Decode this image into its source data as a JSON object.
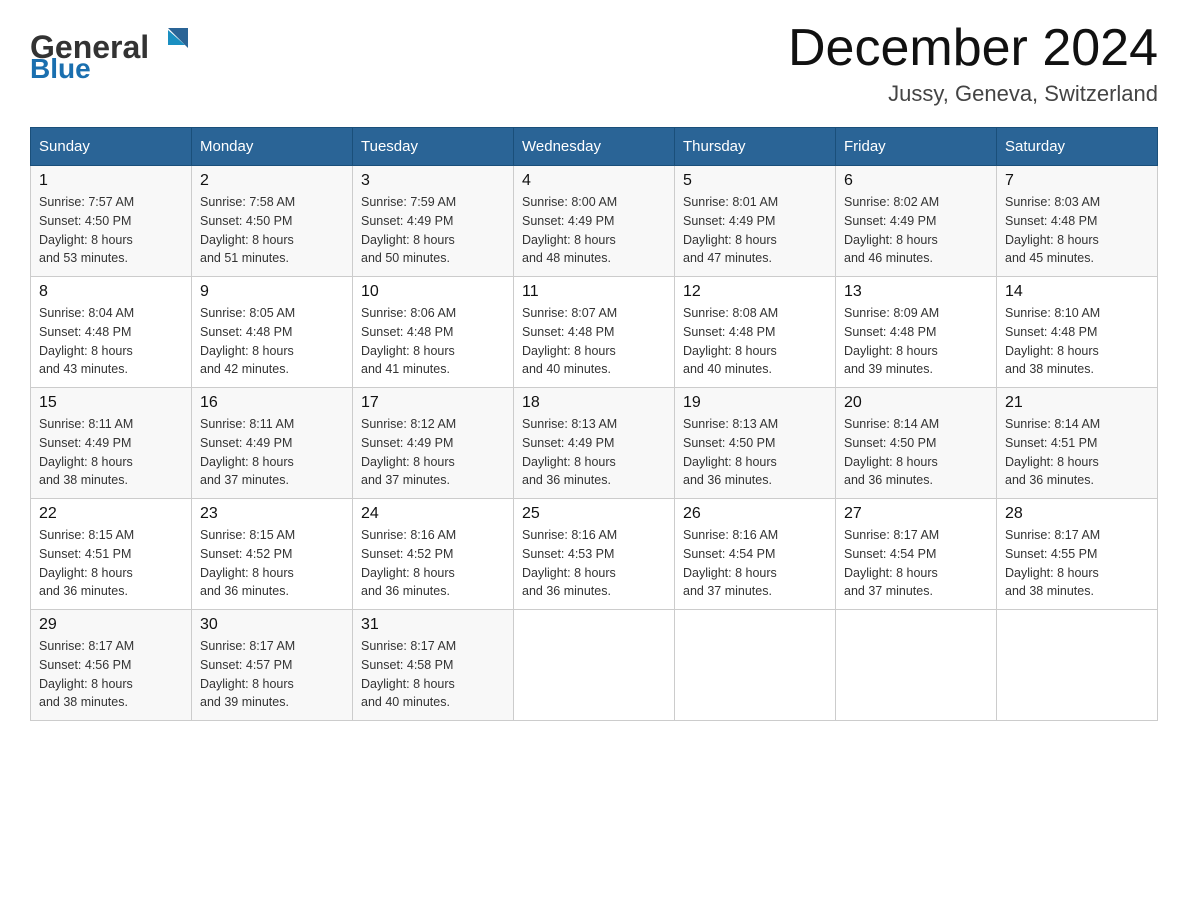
{
  "logo": {
    "text_general": "General",
    "text_blue": "Blue"
  },
  "title": {
    "month": "December 2024",
    "location": "Jussy, Geneva, Switzerland"
  },
  "headers": [
    "Sunday",
    "Monday",
    "Tuesday",
    "Wednesday",
    "Thursday",
    "Friday",
    "Saturday"
  ],
  "weeks": [
    [
      {
        "day": "1",
        "sunrise": "7:57 AM",
        "sunset": "4:50 PM",
        "daylight": "8 hours and 53 minutes."
      },
      {
        "day": "2",
        "sunrise": "7:58 AM",
        "sunset": "4:50 PM",
        "daylight": "8 hours and 51 minutes."
      },
      {
        "day": "3",
        "sunrise": "7:59 AM",
        "sunset": "4:49 PM",
        "daylight": "8 hours and 50 minutes."
      },
      {
        "day": "4",
        "sunrise": "8:00 AM",
        "sunset": "4:49 PM",
        "daylight": "8 hours and 48 minutes."
      },
      {
        "day": "5",
        "sunrise": "8:01 AM",
        "sunset": "4:49 PM",
        "daylight": "8 hours and 47 minutes."
      },
      {
        "day": "6",
        "sunrise": "8:02 AM",
        "sunset": "4:49 PM",
        "daylight": "8 hours and 46 minutes."
      },
      {
        "day": "7",
        "sunrise": "8:03 AM",
        "sunset": "4:48 PM",
        "daylight": "8 hours and 45 minutes."
      }
    ],
    [
      {
        "day": "8",
        "sunrise": "8:04 AM",
        "sunset": "4:48 PM",
        "daylight": "8 hours and 43 minutes."
      },
      {
        "day": "9",
        "sunrise": "8:05 AM",
        "sunset": "4:48 PM",
        "daylight": "8 hours and 42 minutes."
      },
      {
        "day": "10",
        "sunrise": "8:06 AM",
        "sunset": "4:48 PM",
        "daylight": "8 hours and 41 minutes."
      },
      {
        "day": "11",
        "sunrise": "8:07 AM",
        "sunset": "4:48 PM",
        "daylight": "8 hours and 40 minutes."
      },
      {
        "day": "12",
        "sunrise": "8:08 AM",
        "sunset": "4:48 PM",
        "daylight": "8 hours and 40 minutes."
      },
      {
        "day": "13",
        "sunrise": "8:09 AM",
        "sunset": "4:48 PM",
        "daylight": "8 hours and 39 minutes."
      },
      {
        "day": "14",
        "sunrise": "8:10 AM",
        "sunset": "4:48 PM",
        "daylight": "8 hours and 38 minutes."
      }
    ],
    [
      {
        "day": "15",
        "sunrise": "8:11 AM",
        "sunset": "4:49 PM",
        "daylight": "8 hours and 38 minutes."
      },
      {
        "day": "16",
        "sunrise": "8:11 AM",
        "sunset": "4:49 PM",
        "daylight": "8 hours and 37 minutes."
      },
      {
        "day": "17",
        "sunrise": "8:12 AM",
        "sunset": "4:49 PM",
        "daylight": "8 hours and 37 minutes."
      },
      {
        "day": "18",
        "sunrise": "8:13 AM",
        "sunset": "4:49 PM",
        "daylight": "8 hours and 36 minutes."
      },
      {
        "day": "19",
        "sunrise": "8:13 AM",
        "sunset": "4:50 PM",
        "daylight": "8 hours and 36 minutes."
      },
      {
        "day": "20",
        "sunrise": "8:14 AM",
        "sunset": "4:50 PM",
        "daylight": "8 hours and 36 minutes."
      },
      {
        "day": "21",
        "sunrise": "8:14 AM",
        "sunset": "4:51 PM",
        "daylight": "8 hours and 36 minutes."
      }
    ],
    [
      {
        "day": "22",
        "sunrise": "8:15 AM",
        "sunset": "4:51 PM",
        "daylight": "8 hours and 36 minutes."
      },
      {
        "day": "23",
        "sunrise": "8:15 AM",
        "sunset": "4:52 PM",
        "daylight": "8 hours and 36 minutes."
      },
      {
        "day": "24",
        "sunrise": "8:16 AM",
        "sunset": "4:52 PM",
        "daylight": "8 hours and 36 minutes."
      },
      {
        "day": "25",
        "sunrise": "8:16 AM",
        "sunset": "4:53 PM",
        "daylight": "8 hours and 36 minutes."
      },
      {
        "day": "26",
        "sunrise": "8:16 AM",
        "sunset": "4:54 PM",
        "daylight": "8 hours and 37 minutes."
      },
      {
        "day": "27",
        "sunrise": "8:17 AM",
        "sunset": "4:54 PM",
        "daylight": "8 hours and 37 minutes."
      },
      {
        "day": "28",
        "sunrise": "8:17 AM",
        "sunset": "4:55 PM",
        "daylight": "8 hours and 38 minutes."
      }
    ],
    [
      {
        "day": "29",
        "sunrise": "8:17 AM",
        "sunset": "4:56 PM",
        "daylight": "8 hours and 38 minutes."
      },
      {
        "day": "30",
        "sunrise": "8:17 AM",
        "sunset": "4:57 PM",
        "daylight": "8 hours and 39 minutes."
      },
      {
        "day": "31",
        "sunrise": "8:17 AM",
        "sunset": "4:58 PM",
        "daylight": "8 hours and 40 minutes."
      },
      null,
      null,
      null,
      null
    ]
  ],
  "labels": {
    "sunrise": "Sunrise:",
    "sunset": "Sunset:",
    "daylight": "Daylight:"
  }
}
